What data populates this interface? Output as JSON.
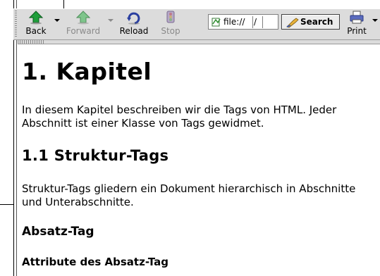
{
  "toolbar": {
    "back_label": "Back",
    "forward_label": "Forward",
    "reload_label": "Reload",
    "stop_label": "Stop",
    "location_text": "file://",
    "location_slash": "/",
    "search_label": "Search",
    "print_label": "Print",
    "icons": [
      "back-arrow-icon",
      "forward-arrow-icon",
      "reload-icon",
      "stop-icon",
      "file-location-icon",
      "search-icon",
      "printer-icon"
    ]
  },
  "document": {
    "h1": "1. Kapitel",
    "p1": "In diesem Kapitel beschreiben wir die Tags von HTML. Jeder Abschnitt ist einer Klasse von Tags gewidmet.",
    "h2": "1.1 Struktur-Tags",
    "p2": "Struktur-Tags gliedern ein Dokument hierarchisch in Abschnitte und Unterabschnitte.",
    "h3": "Absatz-Tag",
    "h4": "Attribute des Absatz-Tag"
  },
  "colors": {
    "toolbar_bg": "#dcdcdc",
    "back_green": "#1e9e3a",
    "forward_green_disabled": "#7ec58b",
    "reload_blue": "#2a3fa0"
  }
}
